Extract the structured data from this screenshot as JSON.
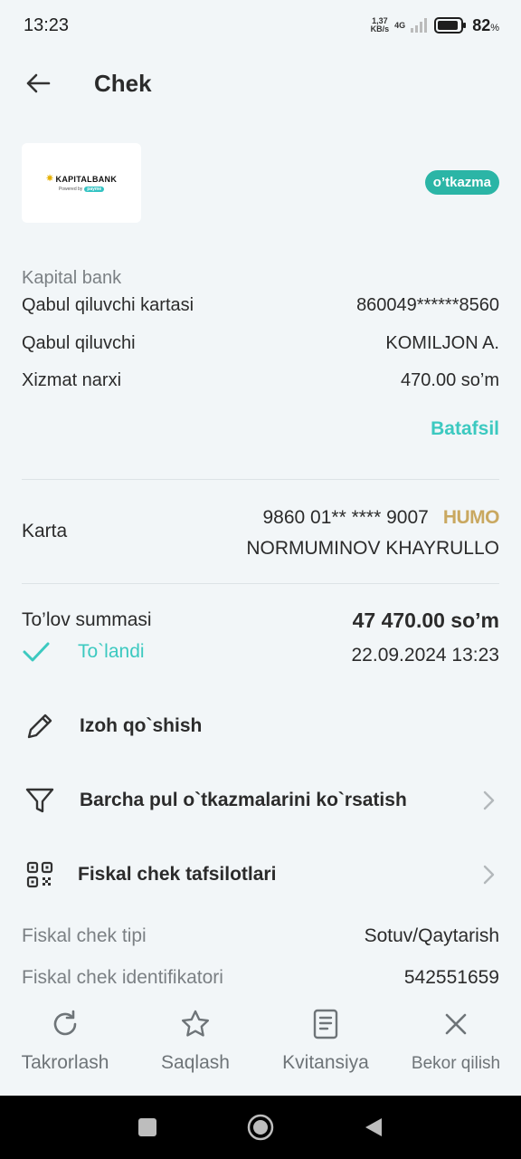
{
  "status_bar": {
    "time": "13:23",
    "net_speed_top": "1,37",
    "net_speed_bottom": "KB/s",
    "network": "4G",
    "battery": "82",
    "battery_unit": "%"
  },
  "header": {
    "title": "Chek"
  },
  "merchant": {
    "logo_name": "KAPITALBANK",
    "logo_powered": "Powered by",
    "logo_payme": "payme",
    "type_badge": "o’tkazma",
    "provider": "Kapital bank"
  },
  "details": [
    {
      "label": "Qabul qiluvchi kartasi",
      "value": "860049******8560"
    },
    {
      "label": "Qabul qiluvchi",
      "value": "KOMILJON A."
    },
    {
      "label": "Xizmat narxi",
      "value": "470.00 so’m"
    }
  ],
  "more_link": "Batafsil",
  "card": {
    "label": "Karta",
    "number": "9860 01** **** 9007",
    "brand": "HUMO",
    "holder": "NORMUMINOV KHAYRULLO"
  },
  "payment": {
    "amount_label": "To’lov summasi",
    "amount_value": "47 470.00 so’m",
    "status": "To`landi",
    "datetime": "22.09.2024 13:23"
  },
  "actions": [
    {
      "label": "Izoh qo`shish",
      "icon": "pencil-icon"
    },
    {
      "label": "Barcha pul o`tkazmalarini ko`rsatish",
      "icon": "filter-icon"
    },
    {
      "label": "Fiskal chek tafsilotlari",
      "icon": "qr-code-icon"
    }
  ],
  "fiscal": [
    {
      "label": "Fiskal chek tipi",
      "value": "Sotuv/Qaytarish"
    },
    {
      "label": "Fiskal chek identifikatori",
      "value": "542551659"
    }
  ],
  "bottom_bar": [
    {
      "label": "Takrorlash",
      "icon": "refresh-icon"
    },
    {
      "label": "Saqlash",
      "icon": "star-icon"
    },
    {
      "label": "Kvitansiya",
      "icon": "receipt-icon"
    },
    {
      "label": "Bekor qilish",
      "icon": "close-icon"
    }
  ],
  "colors": {
    "accent": "#3cc9c0",
    "badge": "#2bb5a6",
    "background": "#f2f6f8",
    "humo": "#c9a860"
  }
}
